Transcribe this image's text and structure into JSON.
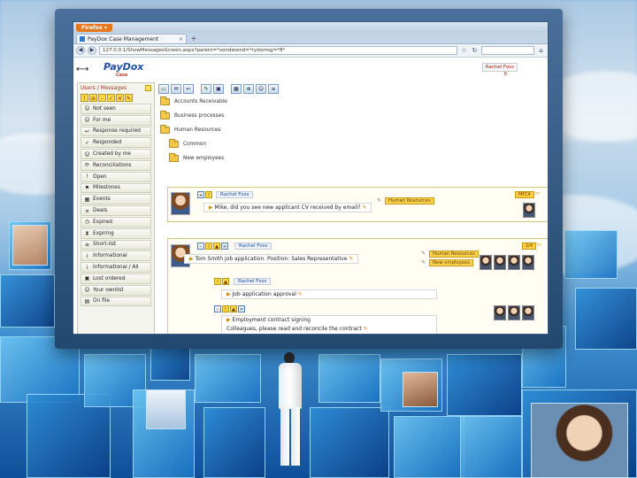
{
  "browser": {
    "menu_button": "Firefox ▾",
    "tab_title": "PayDox Case Management",
    "tab_close": "×",
    "new_tab": "+",
    "url": "127.0.0.1/ShowMessagesScreen.aspx?parent=*vonderend=*rydxmsg=*8*"
  },
  "app": {
    "logo": "PayDox",
    "logo_sub": "Case",
    "user_name": "Rachel Foss",
    "user_count": "8"
  },
  "sidebar": {
    "header": "Users / Messages",
    "items": [
      {
        "label": "Not seen",
        "icon": "person-icon"
      },
      {
        "label": "For me",
        "icon": "person-icon"
      },
      {
        "label": "Response required",
        "icon": "reply-icon"
      },
      {
        "label": "Responded",
        "icon": "check-icon"
      },
      {
        "label": "Created by me",
        "icon": "person-icon"
      },
      {
        "label": "Reconciliations",
        "icon": "sync-icon"
      },
      {
        "label": "Open",
        "icon": "alert-icon"
      },
      {
        "label": "Milestones",
        "icon": "flag-icon"
      },
      {
        "label": "Events",
        "icon": "calendar-icon"
      },
      {
        "label": "Deals",
        "icon": "deal-icon"
      },
      {
        "label": "Expired",
        "icon": "clock-icon"
      },
      {
        "label": "Expiring",
        "icon": "hourglass-icon"
      },
      {
        "label": "Short-list",
        "icon": "list-icon"
      },
      {
        "label": "Informational",
        "icon": "info-icon"
      },
      {
        "label": "Informational / All",
        "icon": "info-icon"
      },
      {
        "label": "Lost ordered",
        "icon": "box-icon"
      },
      {
        "label": "Your ownlist",
        "icon": "person-icon"
      },
      {
        "label": "On file",
        "icon": "file-icon"
      }
    ]
  },
  "folders": [
    {
      "label": "Accounts Receivable",
      "indent": false
    },
    {
      "label": "Business processes",
      "indent": false
    },
    {
      "label": "Human Resources",
      "indent": false
    },
    {
      "label": "Common",
      "indent": true
    },
    {
      "label": "New employees",
      "indent": true
    }
  ],
  "messages": {
    "m1": {
      "sender": "Rachel Foss",
      "text": "Mike, did you see new applicant CV received by email?",
      "tag": "Human Resources",
      "badge": "MFC4"
    },
    "m2": {
      "sender": "Rachel Foss",
      "text": "Tom Smith job application. Position: Sales Representative",
      "tag1": "Human Resources",
      "tag2": "New employees",
      "badge": "2/4"
    },
    "m3": {
      "sender": "Rachel Foss",
      "text": "Job application approval"
    },
    "m4": {
      "text": "Employment contract signing",
      "text2": "Colleagues, please read and reconcile the contract"
    }
  },
  "colors": {
    "accent": "#1f4fa8",
    "tag": "#ffd24d",
    "alert": "#b03020"
  }
}
